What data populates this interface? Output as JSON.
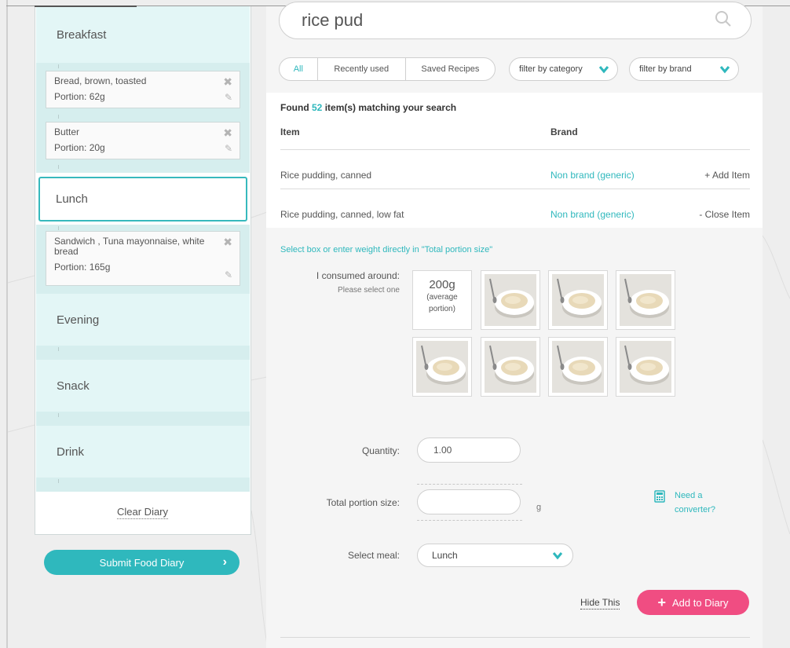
{
  "diary": {
    "meals": [
      {
        "label": "Breakfast",
        "items": [
          {
            "name": "Bread, brown, toasted",
            "portion": "Portion: 62g"
          },
          {
            "name": "Butter",
            "portion": "Portion: 20g"
          }
        ]
      },
      {
        "label": "Lunch",
        "active": true,
        "items": [
          {
            "name": "Sandwich , Tuna mayonnaise, white bread",
            "portion": "Portion: 165g"
          }
        ]
      },
      {
        "label": "Evening",
        "items": []
      },
      {
        "label": "Snack",
        "items": []
      },
      {
        "label": "Drink",
        "items": []
      }
    ],
    "clear_label": "Clear Diary",
    "submit_label": "Submit Food Diary"
  },
  "search": {
    "query": "rice pud"
  },
  "tabs": [
    {
      "label": "All",
      "active": true
    },
    {
      "label": "Recently used"
    },
    {
      "label": "Saved Recipes"
    }
  ],
  "filters": {
    "category": "filter by category",
    "brand": "filter by brand"
  },
  "results": {
    "found_prefix": "Found",
    "found_count": "52",
    "found_suffix": "item(s) matching your search",
    "columns": {
      "item": "Item",
      "brand": "Brand"
    },
    "rows": [
      {
        "item": "Rice pudding, canned",
        "brand": "Non brand (generic)",
        "action": "+ Add Item"
      },
      {
        "item": "Rice pudding, canned, low fat",
        "brand": "Non brand (generic)",
        "action": "- Close Item"
      }
    ]
  },
  "detail": {
    "hint": "Select box or enter weight directly in \"Total portion size\"",
    "consumed_label": "I consumed around:",
    "select_one": "Please select one",
    "avg_tile": {
      "weight": "200g",
      "line1": "(average",
      "line2": "portion)"
    },
    "quantity_label": "Quantity:",
    "quantity_value": "1.00",
    "total_label": "Total portion size:",
    "total_value": "",
    "unit": "g",
    "converter_line1": "Need a",
    "converter_line2": "converter?",
    "meal_label": "Select meal:",
    "meal_value": "Lunch",
    "hide_label": "Hide This",
    "add_label": "Add to Diary"
  },
  "colors": {
    "accent": "#2fb8bd",
    "primary_action": "#f04d82",
    "meal_bg": "#e3f6f6"
  }
}
